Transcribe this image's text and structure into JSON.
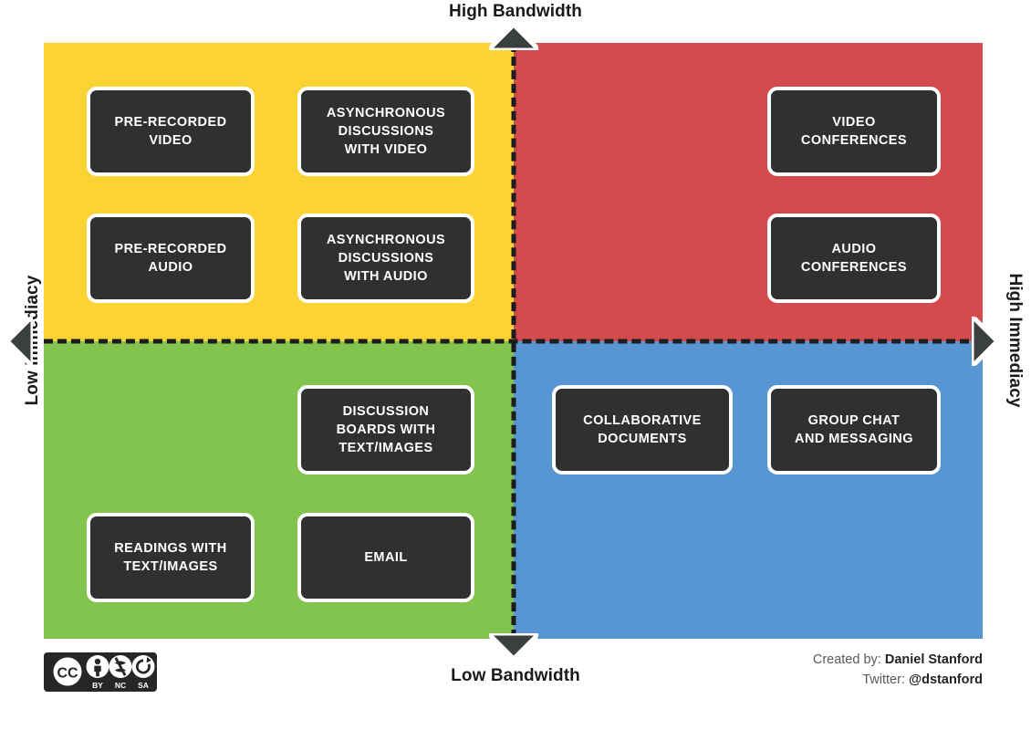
{
  "axes": {
    "top_label": "High Bandwidth",
    "bottom_label": "Low Bandwidth",
    "left_label": "Low Immediacy",
    "right_label": "High Immediacy"
  },
  "colors": {
    "quadrant_top_left": "#FBD335",
    "quadrant_top_right": "#D44B4D",
    "quadrant_bottom_left": "#83C44E",
    "quadrant_bottom_right": "#5795D3",
    "box_fill": "#2E3031",
    "box_border": "#FFFFFF",
    "divider": "#1D1D1D"
  },
  "quadrants": {
    "top_left": {
      "name": "High Bandwidth / Low Immediacy",
      "color": "#FBD335",
      "items": [
        {
          "lines": [
            "PRE-RECORDED",
            "VIDEO"
          ]
        },
        {
          "lines": [
            "ASYNCHRONOUS",
            "DISCUSSIONS",
            "WITH VIDEO"
          ]
        },
        {
          "lines": [
            "PRE-RECORDED",
            "AUDIO"
          ]
        },
        {
          "lines": [
            "ASYNCHRONOUS",
            "DISCUSSIONS",
            "WITH AUDIO"
          ]
        }
      ]
    },
    "top_right": {
      "name": "High Bandwidth / High Immediacy",
      "color": "#D44B4D",
      "items": [
        {
          "lines": [
            "VIDEO",
            "CONFERENCES"
          ]
        },
        {
          "lines": [
            "AUDIO",
            "CONFERENCES"
          ]
        }
      ]
    },
    "bottom_left": {
      "name": "Low Bandwidth / Low Immediacy",
      "color": "#83C44E",
      "items": [
        {
          "lines": [
            "DISCUSSION",
            "BOARDS WITH",
            "TEXT/IMAGES"
          ]
        },
        {
          "lines": [
            "READINGS WITH",
            "TEXT/IMAGES"
          ]
        },
        {
          "lines": [
            "EMAIL"
          ]
        }
      ]
    },
    "bottom_right": {
      "name": "Low Bandwidth / High Immediacy",
      "color": "#5795D3",
      "items": [
        {
          "lines": [
            "COLLABORATIVE",
            "DOCUMENTS"
          ]
        },
        {
          "lines": [
            "GROUP CHAT",
            "AND MESSAGING"
          ]
        }
      ]
    }
  },
  "boxes": [
    {
      "id": "pre-recorded-video",
      "l1": "PRE-RECORDED",
      "l2": "VIDEO",
      "l3": ""
    },
    {
      "id": "async-discussions-video",
      "l1": "ASYNCHRONOUS",
      "l2": "DISCUSSIONS",
      "l3": "WITH VIDEO"
    },
    {
      "id": "video-conferences",
      "l1": "VIDEO",
      "l2": "CONFERENCES",
      "l3": ""
    },
    {
      "id": "pre-recorded-audio",
      "l1": "PRE-RECORDED",
      "l2": "AUDIO",
      "l3": ""
    },
    {
      "id": "async-discussions-audio",
      "l1": "ASYNCHRONOUS",
      "l2": "DISCUSSIONS",
      "l3": "WITH AUDIO"
    },
    {
      "id": "audio-conferences",
      "l1": "AUDIO",
      "l2": "CONFERENCES",
      "l3": ""
    },
    {
      "id": "discussion-boards-text-images",
      "l1": "DISCUSSION",
      "l2": "BOARDS WITH",
      "l3": "TEXT/IMAGES"
    },
    {
      "id": "collaborative-documents",
      "l1": "COLLABORATIVE",
      "l2": "DOCUMENTS",
      "l3": ""
    },
    {
      "id": "group-chat-and-messaging",
      "l1": "GROUP CHAT",
      "l2": "AND MESSAGING",
      "l3": ""
    },
    {
      "id": "readings-with-text-images",
      "l1": "READINGS WITH",
      "l2": "TEXT/IMAGES",
      "l3": ""
    },
    {
      "id": "email",
      "l1": "EMAIL",
      "l2": "",
      "l3": ""
    }
  ],
  "license": {
    "badge": "cc-by-nc-sa",
    "cc": "CC",
    "by": "BY",
    "nc": "NC",
    "sa": "SA"
  },
  "credits": {
    "created_by_label": "Created by:",
    "created_by_name": "Daniel Stanford",
    "twitter_label": "Twitter:",
    "twitter_handle": "@dstanford"
  }
}
